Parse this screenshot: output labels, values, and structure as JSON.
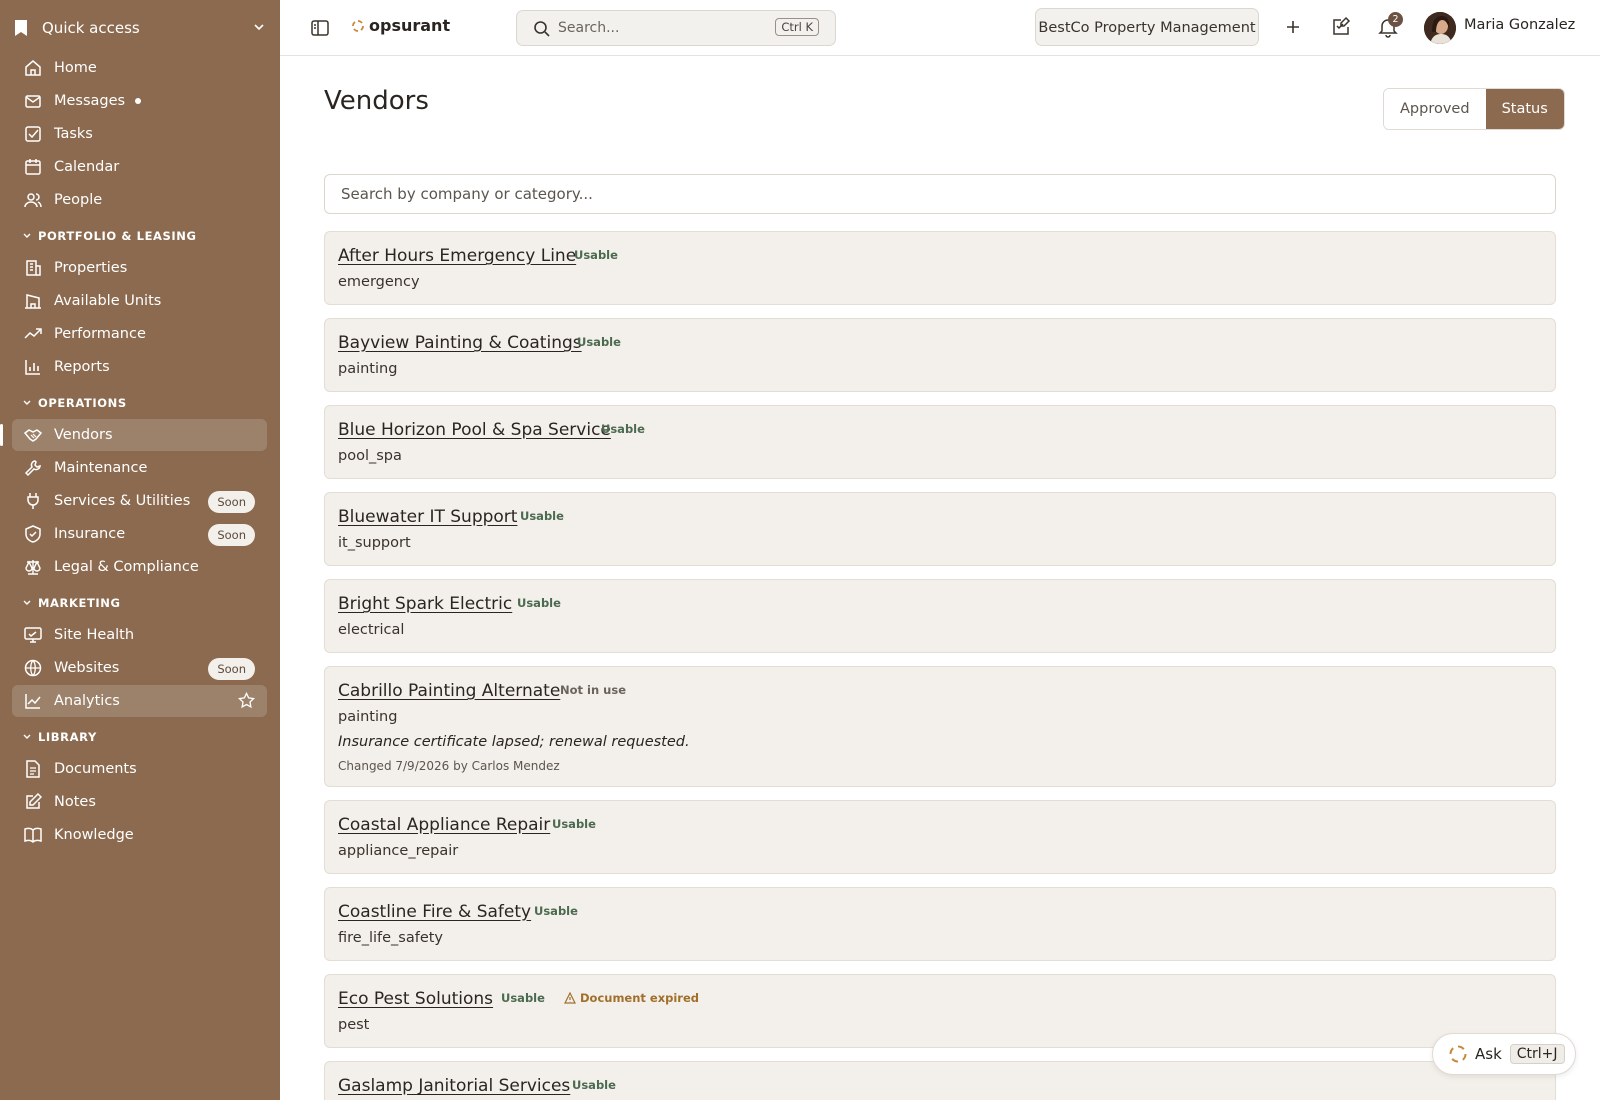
{
  "sidebar": {
    "quick_access": "Quick access",
    "top_items": [
      {
        "label": "Home",
        "icon": "home-icon"
      },
      {
        "label": "Messages",
        "icon": "mail-icon",
        "unread": true
      },
      {
        "label": "Tasks",
        "icon": "checkbox-icon"
      },
      {
        "label": "Calendar",
        "icon": "calendar-icon"
      },
      {
        "label": "People",
        "icon": "people-icon"
      }
    ],
    "sections": [
      {
        "title": "PORTFOLIO & LEASING",
        "items": [
          {
            "label": "Properties",
            "icon": "building-icon"
          },
          {
            "label": "Available Units",
            "icon": "units-icon"
          },
          {
            "label": "Performance",
            "icon": "trend-icon"
          },
          {
            "label": "Reports",
            "icon": "bar-chart-icon"
          }
        ]
      },
      {
        "title": "OPERATIONS",
        "items": [
          {
            "label": "Vendors",
            "icon": "handshake-icon",
            "active": true
          },
          {
            "label": "Maintenance",
            "icon": "wrench-icon"
          },
          {
            "label": "Services & Utilities",
            "icon": "plug-icon",
            "badge": "Soon"
          },
          {
            "label": "Insurance",
            "icon": "shield-icon",
            "badge": "Soon"
          },
          {
            "label": "Legal & Compliance",
            "icon": "scales-icon"
          }
        ]
      },
      {
        "title": "MARKETING",
        "items": [
          {
            "label": "Site Health",
            "icon": "monitor-icon"
          },
          {
            "label": "Websites",
            "icon": "globe-icon",
            "badge": "Soon"
          },
          {
            "label": "Analytics",
            "icon": "line-chart-icon",
            "hover": true
          }
        ]
      },
      {
        "title": "LIBRARY",
        "items": [
          {
            "label": "Documents",
            "icon": "document-icon"
          },
          {
            "label": "Notes",
            "icon": "edit-icon"
          },
          {
            "label": "Knowledge",
            "icon": "book-icon"
          }
        ]
      }
    ]
  },
  "topbar": {
    "brand": "opsurant",
    "search_placeholder": "Search...",
    "search_shortcut": "Ctrl K",
    "org": "BestCo Property Management",
    "notifications": "2",
    "user": "Maria Gonzalez"
  },
  "page": {
    "title": "Vendors",
    "toggle": {
      "approved": "Approved",
      "status": "Status",
      "selected": "Status"
    },
    "filter_placeholder": "Search by company or category..."
  },
  "vendors": [
    {
      "name": "After Hours Emergency Line",
      "status": "Usable",
      "category": "emergency"
    },
    {
      "name": "Bayview Painting & Coatings",
      "status": "Usable",
      "category": "painting"
    },
    {
      "name": "Blue Horizon Pool & Spa Service",
      "status": "Usable",
      "category": "pool_spa"
    },
    {
      "name": "Bluewater IT Support",
      "status": "Usable",
      "category": "it_support"
    },
    {
      "name": "Bright Spark Electric",
      "status": "Usable",
      "category": "electrical"
    },
    {
      "name": "Cabrillo Painting Alternate",
      "status": "Not in use",
      "category": "painting",
      "note": "Insurance certificate lapsed; renewal requested.",
      "changed": "Changed 7/9/2026 by Carlos Mendez"
    },
    {
      "name": "Coastal Appliance Repair",
      "status": "Usable",
      "category": "appliance_repair"
    },
    {
      "name": "Coastline Fire & Safety",
      "status": "Usable",
      "category": "fire_life_safety"
    },
    {
      "name": "Eco Pest Solutions",
      "status": "Usable",
      "category": "pest",
      "warning": "Document expired"
    },
    {
      "name": "Gaslamp Janitorial Services",
      "status": "Usable",
      "category": ""
    }
  ],
  "ask": {
    "label": "Ask",
    "shortcut": "Ctrl+J"
  }
}
